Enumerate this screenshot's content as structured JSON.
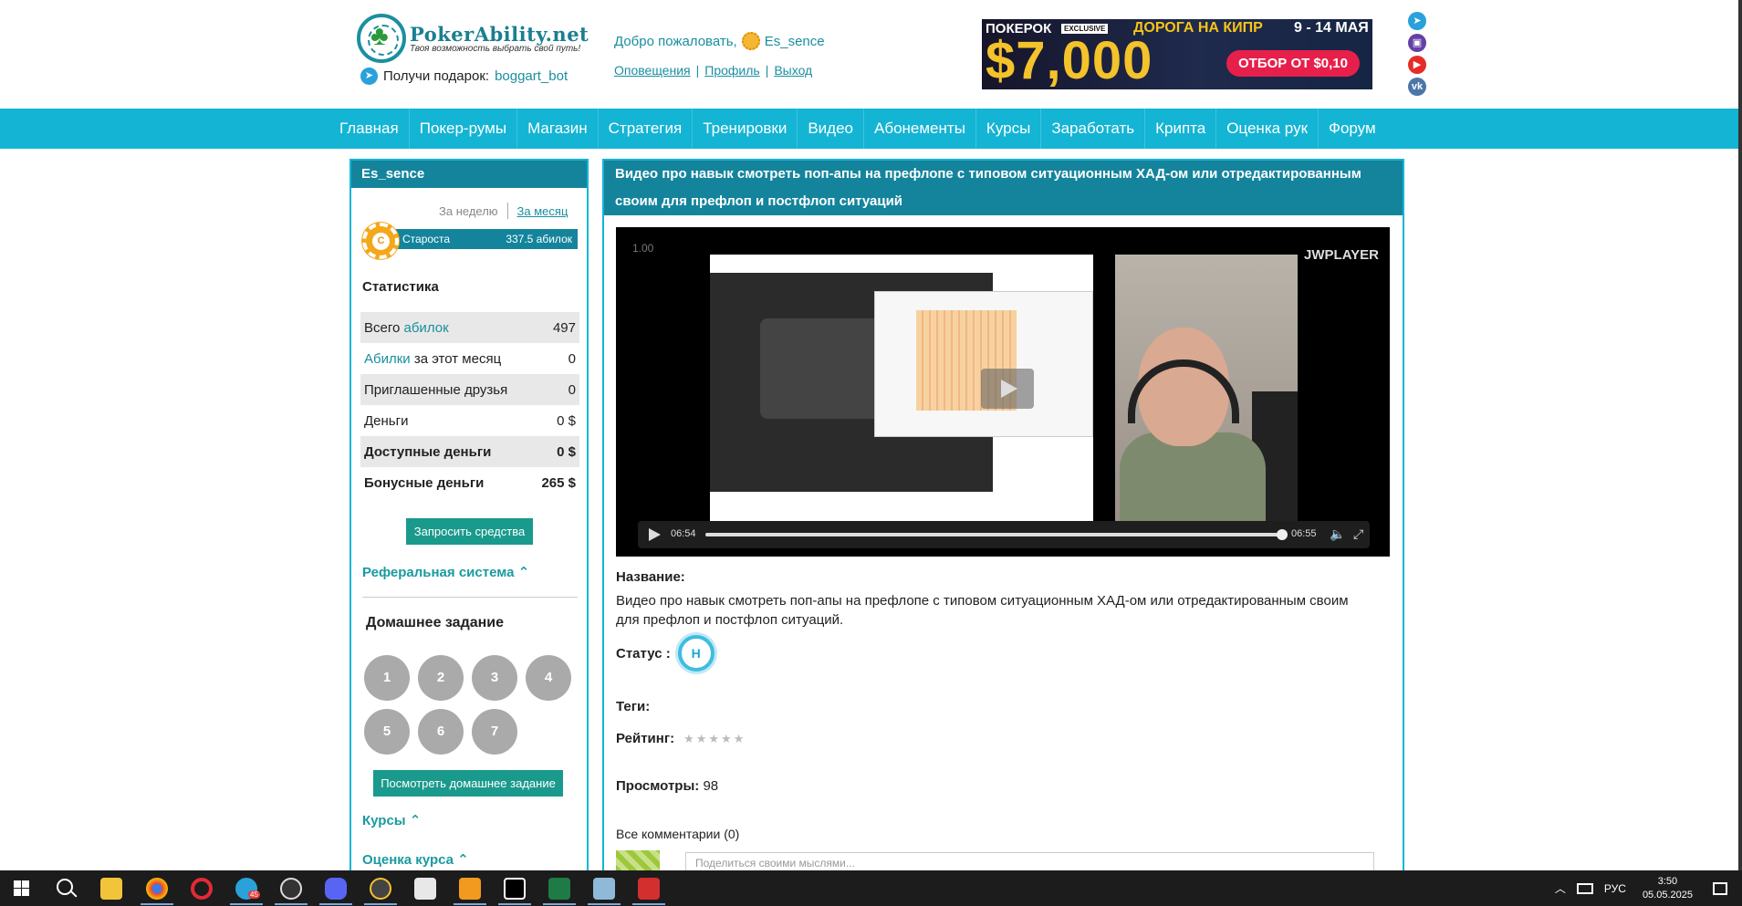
{
  "header": {
    "logo_title": "PokerAbility.net",
    "logo_subtitle": "Твоя возможность выбрать свой путь!",
    "gift_label": "Получи подарок:",
    "gift_link": "boggart_bot",
    "welcome": "Добро пожаловать,",
    "username": "Es_sence",
    "links": [
      "Оповещения",
      "Профиль",
      "Выход"
    ],
    "banner": {
      "brand": "ПОКЕРОК",
      "badge": "EXCLUSIVE",
      "route": "ДОРОГА НА КИПР",
      "dates": "9 - 14 МАЯ",
      "amount": "$7,000",
      "cta": "ОТБОР ОТ $0,10"
    },
    "social_icons": [
      "telegram-icon",
      "twitch-icon",
      "youtube-icon",
      "vk-icon"
    ]
  },
  "nav": [
    "Главная",
    "Покер-румы",
    "Магазин",
    "Стратегия",
    "Тренировки",
    "Видео",
    "Абонементы",
    "Курсы",
    "Заработать",
    "Крипта",
    "Оценка рук",
    "Форум"
  ],
  "sidebar": {
    "username": "Es_sence",
    "period_week": "За неделю",
    "period_month": "За месяц",
    "rank_letter": "C",
    "rank_name": "Староста",
    "rank_points": "337.5 абилок",
    "stats_title": "Статистика",
    "stats": [
      {
        "pre": "Всего ",
        "hl": "абилок",
        "post": "",
        "value": "497"
      },
      {
        "pre": "",
        "hl": "Абилки",
        "post": " за этот месяц",
        "value": "0"
      },
      {
        "pre": "Приглашенные друзья",
        "hl": "",
        "post": "",
        "value": "0"
      },
      {
        "pre": "Деньги",
        "hl": "",
        "post": "",
        "value": "0 $"
      },
      {
        "pre": "Доступные деньги",
        "hl": "",
        "post": "",
        "value": "0 $"
      },
      {
        "pre": "Бонусные деньги",
        "hl": "",
        "post": "",
        "value": "265 $"
      }
    ],
    "request_button": "Запросить средства",
    "referral": "Реферальная система",
    "homework_title": "Домашнее задание",
    "homework_items": [
      "1",
      "2",
      "3",
      "4",
      "5",
      "6",
      "7"
    ],
    "homework_button": "Посмотреть домашнее задание",
    "courses": "Курсы",
    "evaluation": "Оценка курса"
  },
  "main": {
    "title": "Видео про навык смотреть поп-апы на префлопе с типовом ситуационным ХАД-ом или отредактированным своим для префлоп и постфлоп ситуаций",
    "video": {
      "rate": "1.00",
      "player": "JWPLAYER",
      "time_current": "06:54",
      "time_total": "06:55",
      "progress": 0.994
    },
    "name_label": "Название:",
    "name_value": "Видео про навык смотреть поп-апы на префлопе с типовом ситуационным ХАД-ом или отредактированным своим для префлоп и постфлоп ситуаций.",
    "status_label": "Статус :",
    "status_value": "Н",
    "tags_label": "Теги:",
    "rating_label": "Рейтинг:",
    "rating_stars": "★★★★★",
    "rating_value": 0,
    "views_label": "Просмотры:",
    "views_value": "98",
    "comments_label": "Все комментарии (0)",
    "comment_placeholder": "Поделиться своими мыслями..."
  },
  "taskbar": {
    "apps": [
      "file-explorer-icon",
      "chrome-icon",
      "opera-icon",
      "telegram-icon",
      "obs-icon",
      "discord-icon",
      "winamp-icon",
      "notepad-icon",
      "pokertracker-icon",
      "pycharm-icon",
      "excel-icon",
      "notes-icon",
      "holdem-manager-icon"
    ],
    "telegram_badge": "45",
    "lang": "РУС",
    "time": "3:50",
    "date": "05.05.2025"
  }
}
